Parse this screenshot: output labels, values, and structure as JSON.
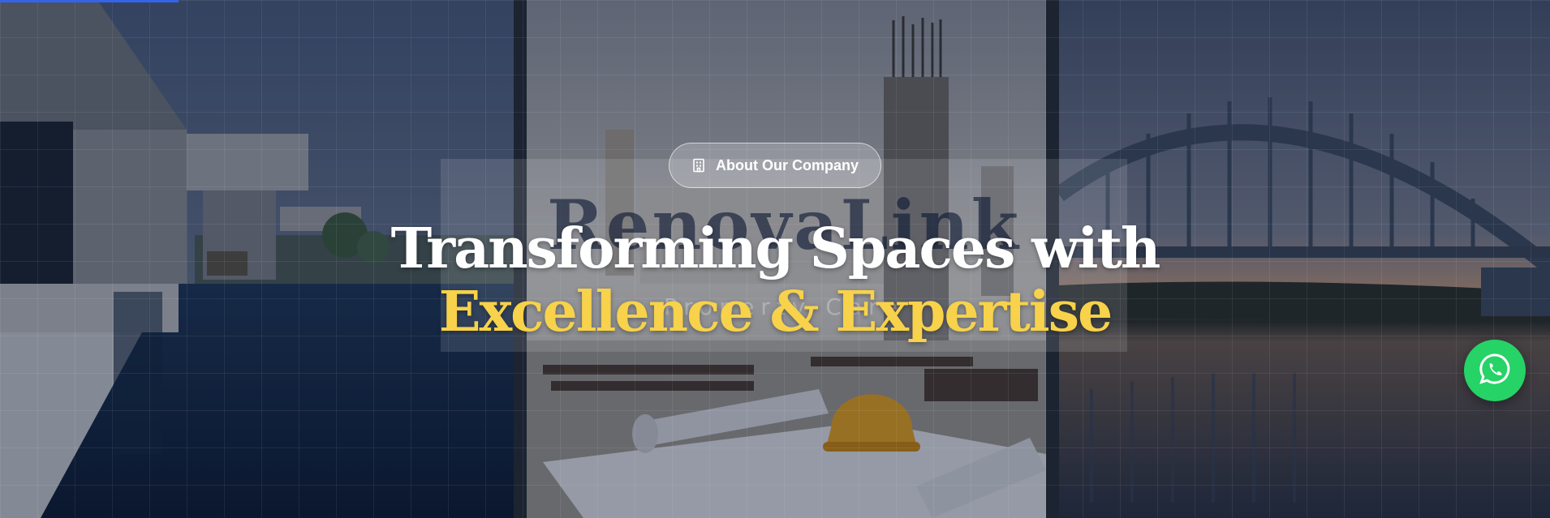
{
  "hero": {
    "badge_label": "About Our Company",
    "badge_icon": "building-icon",
    "headline_line1": "Transforming Spaces with",
    "headline_line2": "Excellence & Expertise",
    "watermark_text": "RenovaLink",
    "watermark_sub": "Property Care",
    "panels": [
      "modern-villa-with-pool-photo",
      "construction-site-with-blueprints-photo",
      "arch-bridge-at-sunset-photo"
    ]
  },
  "whatsapp": {
    "icon": "whatsapp-icon"
  },
  "colors": {
    "headline_white": "#ffffff",
    "headline_accent": "#f7d24a",
    "whatsapp_green": "#25d366",
    "top_accent_bar": "#3563e9"
  }
}
